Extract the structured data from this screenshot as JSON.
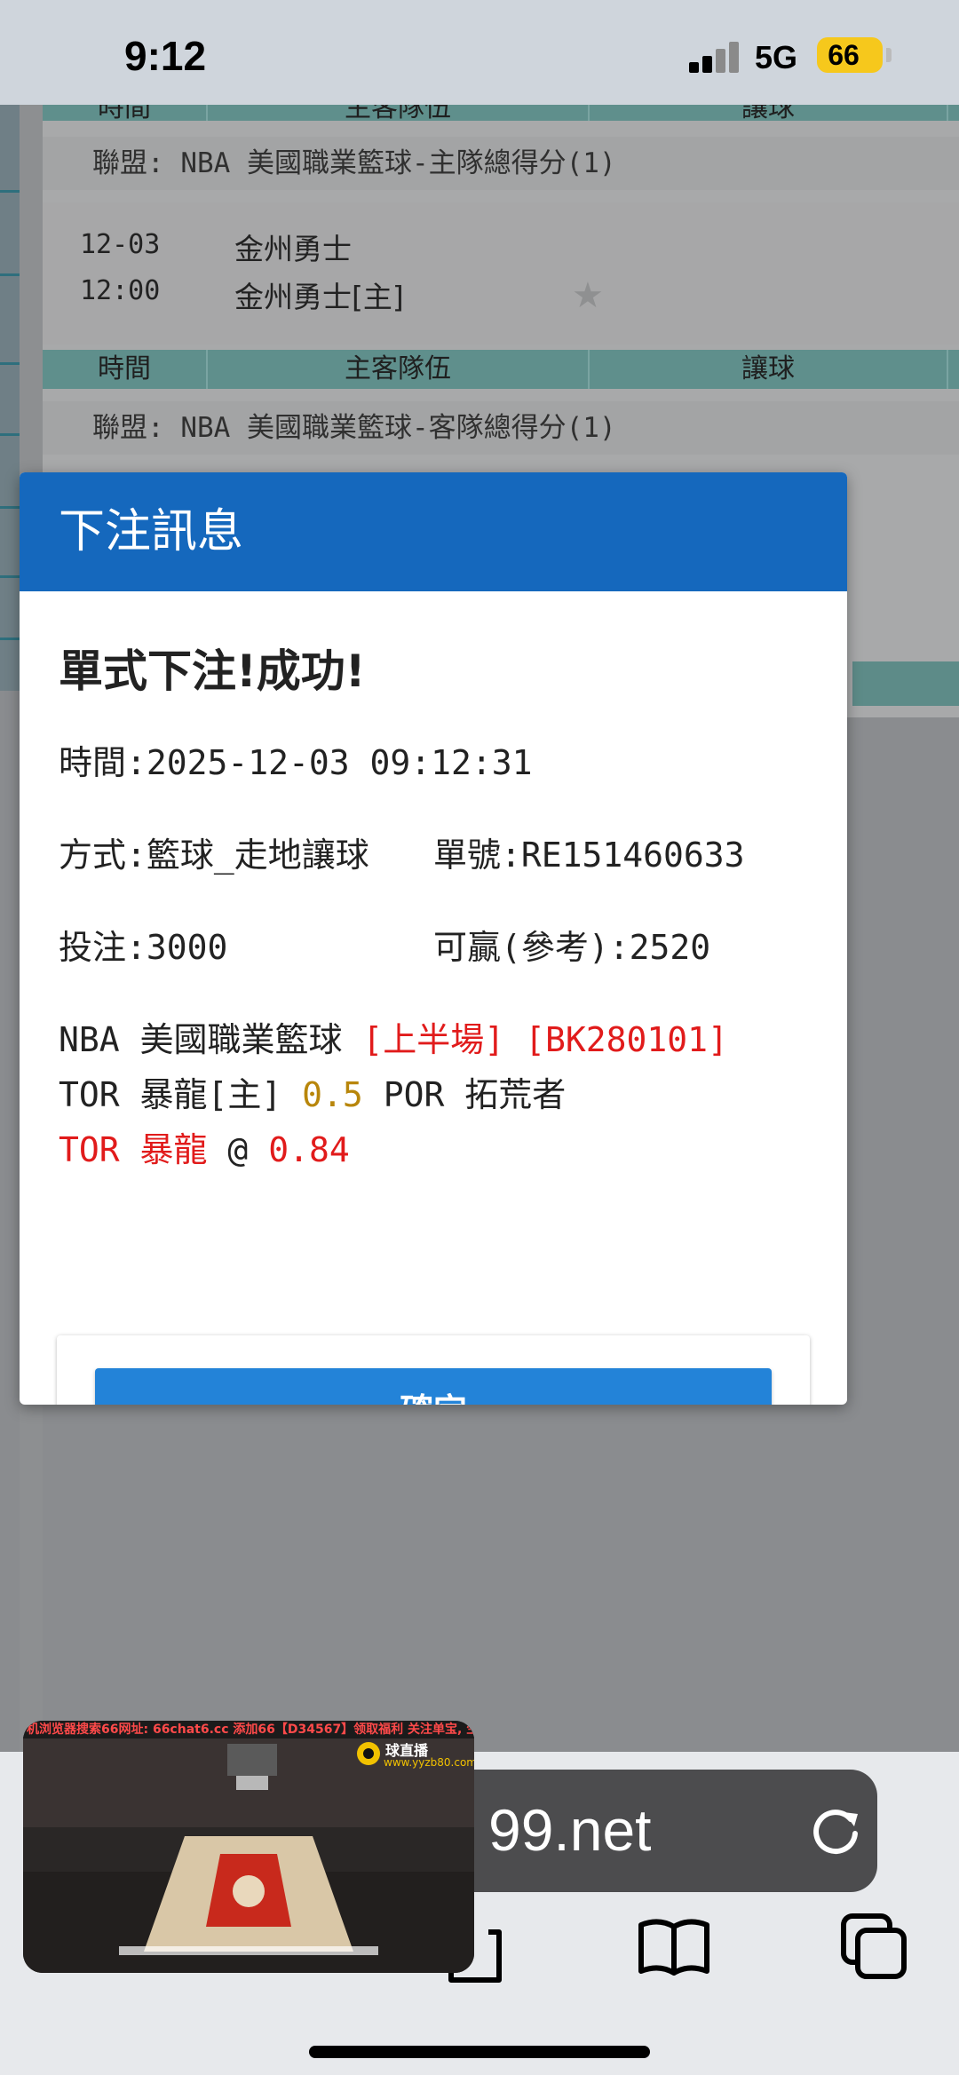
{
  "status_bar": {
    "time": "9:12",
    "network": "5G",
    "battery": "66"
  },
  "background_table": {
    "header_top": [
      "時間",
      "主客隊伍",
      "讓球"
    ],
    "league_1": "聯盟: NBA 美國職業籃球-主隊總得分(1)",
    "match": {
      "date": "12-03",
      "time": "12:00",
      "team_1": "金州勇士",
      "team_2": "金州勇士[主]"
    },
    "header_2": [
      "時間",
      "主客隊伍",
      "讓球"
    ],
    "league_2": "聯盟: NBA 美國職業籃球-客隊總得分(1)"
  },
  "modal": {
    "title": "下注訊息",
    "success": "單式下注!成功!",
    "time_line": "時間:2025-12-03 09:12:31",
    "method": "方式:籃球_走地讓球",
    "ticket": "單號:RE151460633",
    "stake": "投注:3000",
    "win": "可贏(參考):2520",
    "league_name": "NBA 美國職業籃球",
    "half": "[上半場]",
    "code": "[BK280101]",
    "home_team": "TOR 暴龍[主]",
    "handicap": "0.5",
    "away_team": "POR 拓荒者",
    "pick_team": "TOR 暴龍",
    "at": "@",
    "odds": "0.84",
    "ok_label": "確定"
  },
  "browser": {
    "url": "99.net"
  },
  "pip": {
    "ticker": "机浏览器搜索66网址: 66chat6.cc 添加66【D34567】领取福利 关注单宝, 生活拖",
    "logo_text": "球直播",
    "logo_url": "www.yyzb80.com"
  },
  "colors": {
    "modal_header": "#1568bd",
    "ok_button": "#2383d8",
    "accent_red": "#e11b1b",
    "handicap_gold": "#b8860b"
  }
}
